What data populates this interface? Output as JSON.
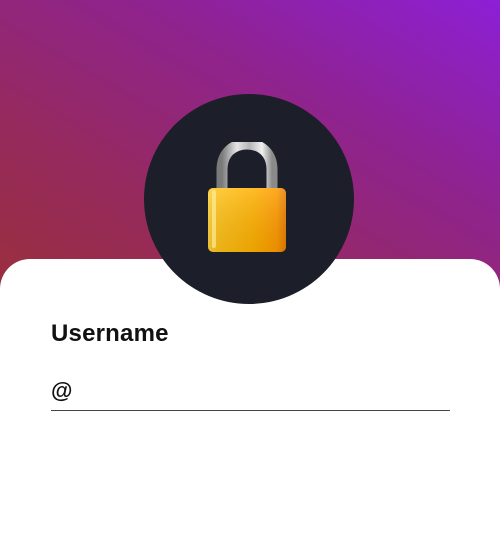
{
  "colors": {
    "gradient_start": "#9a2f3c",
    "gradient_end": "#8d1fd6",
    "avatar_bg": "#1c1f2a",
    "lock_body": "#ffb000",
    "text": "#111111"
  },
  "header": {
    "icon": "lock-icon"
  },
  "form": {
    "username_label": "Username",
    "username_prefix": "@",
    "username_value": "",
    "username_placeholder": ""
  }
}
